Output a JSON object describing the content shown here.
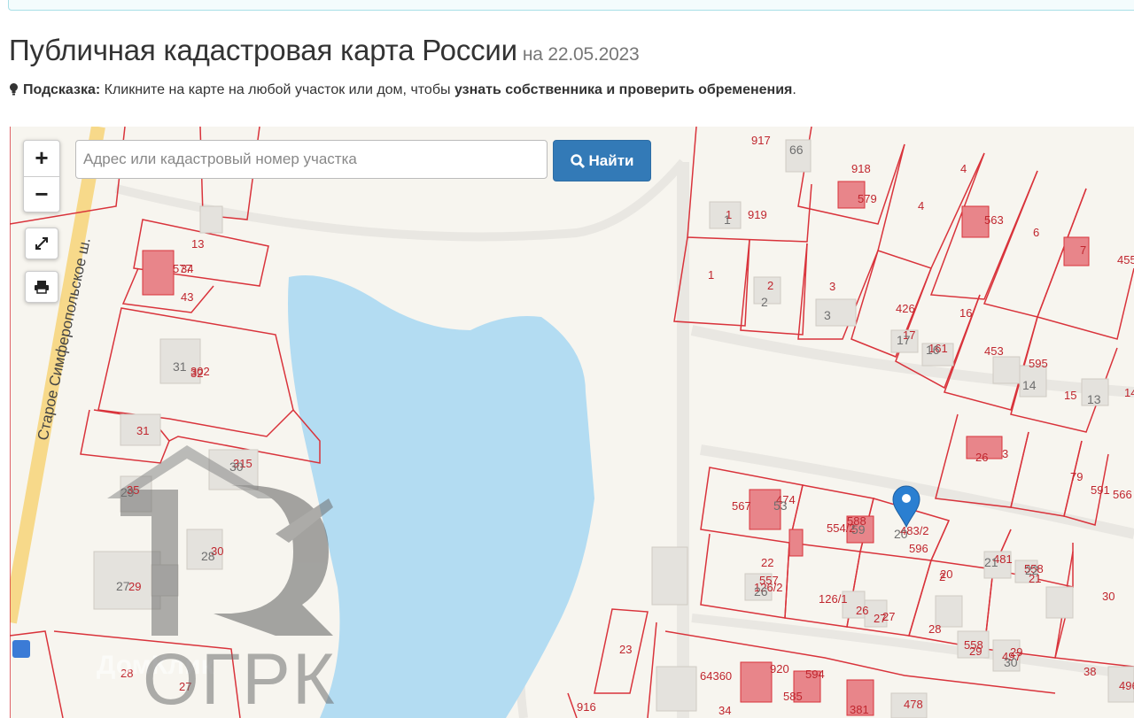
{
  "page": {
    "title": "Публичная кадастровая карта России",
    "date_label": "на 22.05.2023"
  },
  "hint": {
    "label": "Подсказка:",
    "text": " Кликните на карте на любой участок или дом, чтобы ",
    "emphasis": "узнать собственника и проверить обременения",
    "end": "."
  },
  "search": {
    "placeholder": "Адрес или кадастровый номер участка",
    "value": "",
    "button_label": "Найти"
  },
  "controls": {
    "zoom_in": "+",
    "zoom_out": "−"
  },
  "map": {
    "road_label": "Старое Симферопольское ш.",
    "watermark_text": "ОГРК",
    "watermark_faint": "ДомКлик",
    "parcel_labels": [
      "917",
      "918",
      "579",
      "4",
      "4",
      "563",
      "6",
      "7",
      "455",
      "1",
      "919",
      "1",
      "2",
      "3",
      "426",
      "16",
      "17",
      "161",
      "453",
      "595",
      "15",
      "14",
      "13",
      "577",
      "34",
      "43",
      "32",
      "302",
      "31",
      "315",
      "35",
      "30",
      "29",
      "28",
      "27",
      "26",
      "3",
      "79",
      "591",
      "566",
      "78",
      "567",
      "474",
      "554/2",
      "588",
      "483/2",
      "596",
      "20",
      "481",
      "558",
      "21",
      "22",
      "557",
      "126/2",
      "126/1",
      "26",
      "27",
      "27",
      "2",
      "28",
      "558",
      "29",
      "29",
      "497",
      "30",
      "23",
      "64360",
      "920",
      "585",
      "594",
      "381",
      "478",
      "38",
      "496",
      "34",
      "916",
      "59",
      "39"
    ],
    "building_labels": [
      "66",
      "1",
      "2",
      "3",
      "17",
      "16",
      "14",
      "13",
      "31",
      "29",
      "28",
      "27",
      "30",
      "53",
      "59",
      "21",
      "22",
      "26",
      "20",
      "30"
    ]
  },
  "icons": [
    "lightbulb-icon",
    "plus-icon",
    "minus-icon",
    "fullscreen-icon",
    "print-icon",
    "search-icon",
    "map-marker-icon"
  ],
  "colors": {
    "parcel_border": "#d9333b",
    "water": "#b3dcf2",
    "button": "#337ab7",
    "marker": "#2a7fd1"
  }
}
